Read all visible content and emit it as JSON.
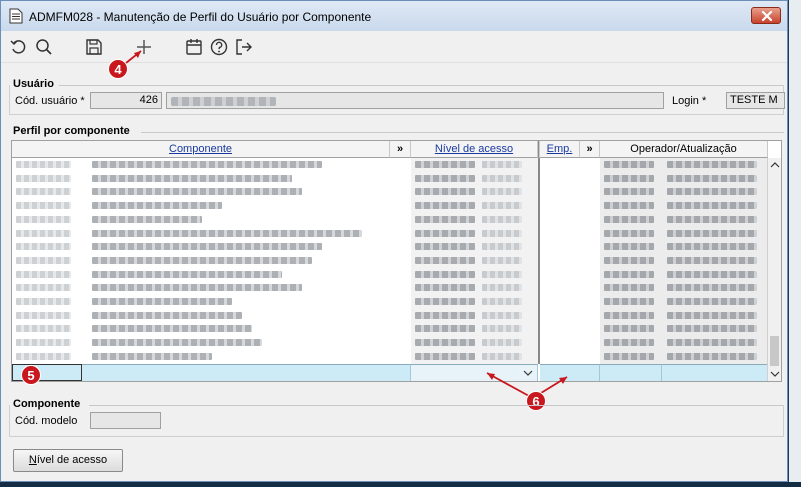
{
  "window": {
    "title": "ADMFM028 - Manutenção de Perfil do Usuário por Componente"
  },
  "toolbar": {
    "icons": [
      "undo-icon",
      "search-icon",
      "save-icon",
      "add-icon",
      "calendar-icon",
      "help-icon",
      "exit-icon"
    ]
  },
  "markers": {
    "m4": "4",
    "m5": "5",
    "m6": "6"
  },
  "usuario": {
    "group_title": "Usuário",
    "cod_label": "Cód. usuário *",
    "cod_value": "426",
    "login_label": "Login *",
    "login_value": "TESTE M"
  },
  "perfil": {
    "group_title": "Perfil por componente",
    "columns": {
      "componente": "Componente",
      "expand1": "»",
      "nivel": "Nível de acesso",
      "emp": "Emp.",
      "expand2": "»",
      "operador": "Operador/Atualização"
    }
  },
  "componente": {
    "group_title": "Componente",
    "cod_modelo_label": "Cód. modelo",
    "cod_modelo_value": ""
  },
  "buttons": {
    "nivel_prefix": "N",
    "nivel_rest": "ível de acesso"
  },
  "colors": {
    "accent": "#1a3aa0",
    "marker": "#c8181e",
    "new_row": "#cdeaf7"
  }
}
